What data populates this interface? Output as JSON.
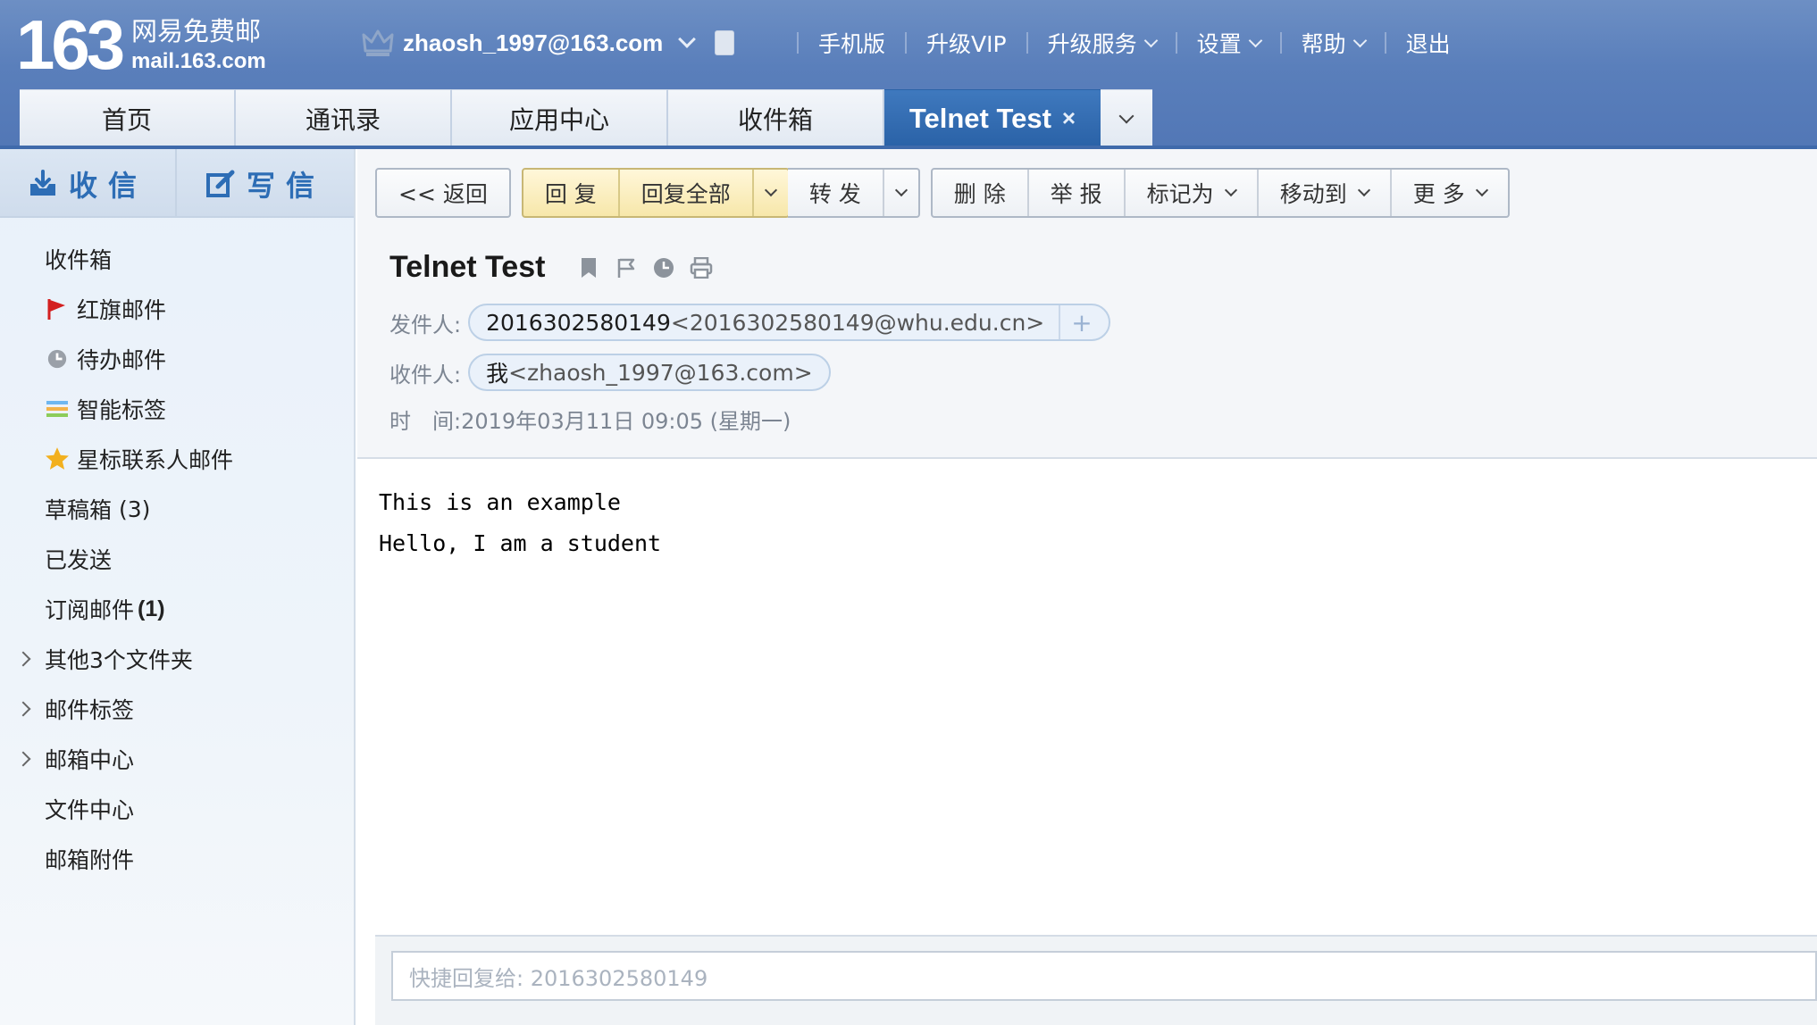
{
  "logo": {
    "number": "163",
    "name": "网易免费邮",
    "domain": "mail.163.com"
  },
  "user": {
    "email": "zhaosh_1997@163.com"
  },
  "topnav": {
    "mobile": "手机版",
    "upgrade_vip": "升级VIP",
    "upgrade_service": "升级服务",
    "settings": "设置",
    "help": "帮助",
    "logout": "退出"
  },
  "tabs": [
    {
      "label": "首页"
    },
    {
      "label": "通讯录"
    },
    {
      "label": "应用中心"
    },
    {
      "label": "收件箱"
    },
    {
      "label": "Telnet Test",
      "close": "×"
    }
  ],
  "sidebar": {
    "receive": "收信",
    "compose": "写信",
    "items": [
      {
        "label": "收件箱"
      },
      {
        "label": "红旗邮件",
        "icon": "flag-icon"
      },
      {
        "label": "待办邮件",
        "icon": "clock-icon"
      },
      {
        "label": "智能标签",
        "icon": "tags-icon"
      },
      {
        "label": "星标联系人邮件",
        "icon": "star-icon"
      },
      {
        "label": "草稿箱",
        "count": "(3)"
      },
      {
        "label": "已发送"
      },
      {
        "label": "订阅邮件",
        "count": "(1)"
      },
      {
        "label": "其他3个文件夹"
      },
      {
        "label": "邮件标签"
      },
      {
        "label": "邮箱中心"
      },
      {
        "label": "文件中心"
      },
      {
        "label": "邮箱附件"
      }
    ]
  },
  "toolbar": {
    "back": "<< 返回",
    "reply": "回 复",
    "reply_all": "回复全部",
    "forward": "转 发",
    "delete": "删 除",
    "report": "举 报",
    "mark_as": "标记为",
    "move_to": "移动到",
    "more": "更 多"
  },
  "message": {
    "subject": "Telnet Test",
    "from_label": "发件人:",
    "from_name": "2016302580149",
    "from_addr": "<2016302580149@whu.edu.cn>",
    "to_label": "收件人:",
    "to_name": "我",
    "to_addr": "<zhaosh_1997@163.com>",
    "time_label": "时　间:",
    "time_value": "2019年03月11日 09:05 (星期一)",
    "body_lines": [
      "This is an example",
      "Hello, I am a student"
    ]
  },
  "quick_reply": {
    "placeholder": "快捷回复给: 2016302580149"
  },
  "colors": {
    "header": "#5a7fbb",
    "active_tab": "#2a62a7",
    "accent": "#2d6db5",
    "flag": "#d32020",
    "star": "#f2b01e"
  }
}
